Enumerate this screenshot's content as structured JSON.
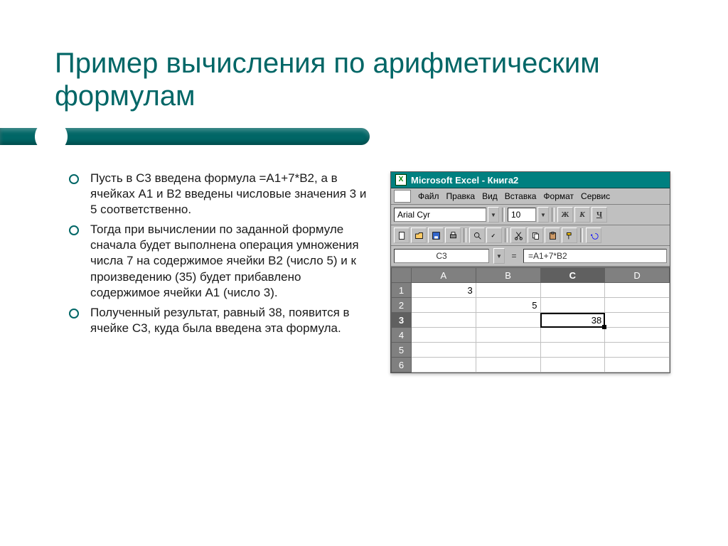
{
  "title": "Пример вычисления по арифметическим формулам",
  "bullets": [
    "Пусть в С3 введена формула =А1+7*В2, а в ячейках А1 и В2 введены числовые значения 3 и 5 соответственно.",
    "Тогда при вычислении по заданной формуле сначала будет выполнена операция умножения числа 7 на содержимое ячейки В2 (число 5) и к произведению (35) будет прибавлено содержимое ячейки А1 (число 3).",
    "Полученный результат, равный 38, появится в ячейке С3, куда была введена эта формула."
  ],
  "excel": {
    "titlebar": "Microsoft Excel - Книга2",
    "menus": [
      "Файл",
      "Правка",
      "Вид",
      "Вставка",
      "Формат",
      "Сервис"
    ],
    "font_name": "Arial Cyr",
    "font_size": "10",
    "style_bold": "Ж",
    "style_italic": "К",
    "style_underline": "Ч",
    "namebox": "C3",
    "formula_eq": "=",
    "formula": "=A1+7*B2",
    "columns": [
      "A",
      "B",
      "C",
      "D"
    ],
    "rows": [
      "1",
      "2",
      "3",
      "4",
      "5",
      "6"
    ],
    "active_col": "C",
    "active_row": "3",
    "cells": {
      "A1": "3",
      "B2": "5",
      "C3": "38"
    }
  }
}
